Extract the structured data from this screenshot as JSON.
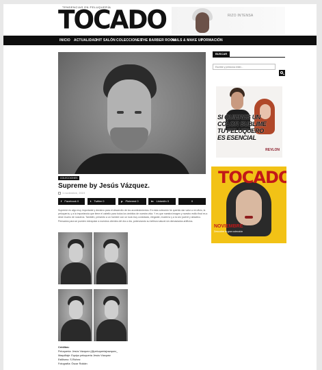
{
  "header": {
    "logo_tagline": "TENDENCIAS EN PELUQUERÍA",
    "logo": "TOCADO",
    "ad_text": "RIZO INTENSA"
  },
  "nav": [
    {
      "label": "INICIO"
    },
    {
      "label": "ACTUALIDAD"
    },
    {
      "label": "HIT SALÓN"
    },
    {
      "label": "COLECCIONES"
    },
    {
      "label": "THE BARBER ROOM"
    },
    {
      "label": "NAILS & MAKE UP"
    },
    {
      "label": "FORMACIÓN"
    }
  ],
  "article": {
    "category": "COLECCIONES",
    "title": "Supreme by Jesús Vázquez.",
    "date": "1 noviembre, 2019",
    "share": [
      {
        "icon": "f",
        "label": "Facebook",
        "count": "0"
      },
      {
        "icon": "t",
        "label": "Twitter",
        "count": "0"
      },
      {
        "icon": "p",
        "label": "Pinterest",
        "count": "0"
      },
      {
        "icon": "in",
        "label": "LinkedIn",
        "count": "0"
      },
      {
        "icon": "",
        "label": "",
        "count": "0"
      }
    ],
    "body": "Supreme es algo muy importante y decisivo para el desarrollo de los acontecimientos. En esta colección he querido dar valor a mi oficio, la peluquería, y a la importancia que tiene el cabello para todos los ámbitos de nuestra vida. Y es que nuestra imagen y nuestro estilo final es a decir mucho de nosotros. También, presento a un hombre con un look muy conectado, elegante, moderno y a la vez juvenil y atractivo. Pensados para se pueden extrapolar a nuestros clientes del día a día, potenciando su belleza natural sin demasiados artificios.",
    "credits": {
      "heading": "Créditos:",
      "lines": [
        "Peluquería: Jesús Vázquez (@peluqueriajvazquez_",
        "Maquillaje: Equipo peluquería Jesús Vázquez",
        "Estilismo: S.Richez",
        "Fotografía: Óscar Roldán"
      ]
    }
  },
  "sidebar": {
    "search_title": "BUSCAR",
    "search_placeholder": "Escribe y presiona enter...",
    "ad": {
      "headline": "SI QUIERES UN COLOR SUBLIME TU PELUQUERO ES ESENCIAL",
      "brand": "REVLON"
    },
    "magazine": {
      "logo": "TOCADO",
      "cover_title": "NOVIEMBRE",
      "cover_sub": "Descubre la gran colección"
    }
  },
  "colors": {
    "nav_bg": "#0e0e0e",
    "magazine_bg": "#f2c216",
    "magazine_red": "#c21818"
  }
}
